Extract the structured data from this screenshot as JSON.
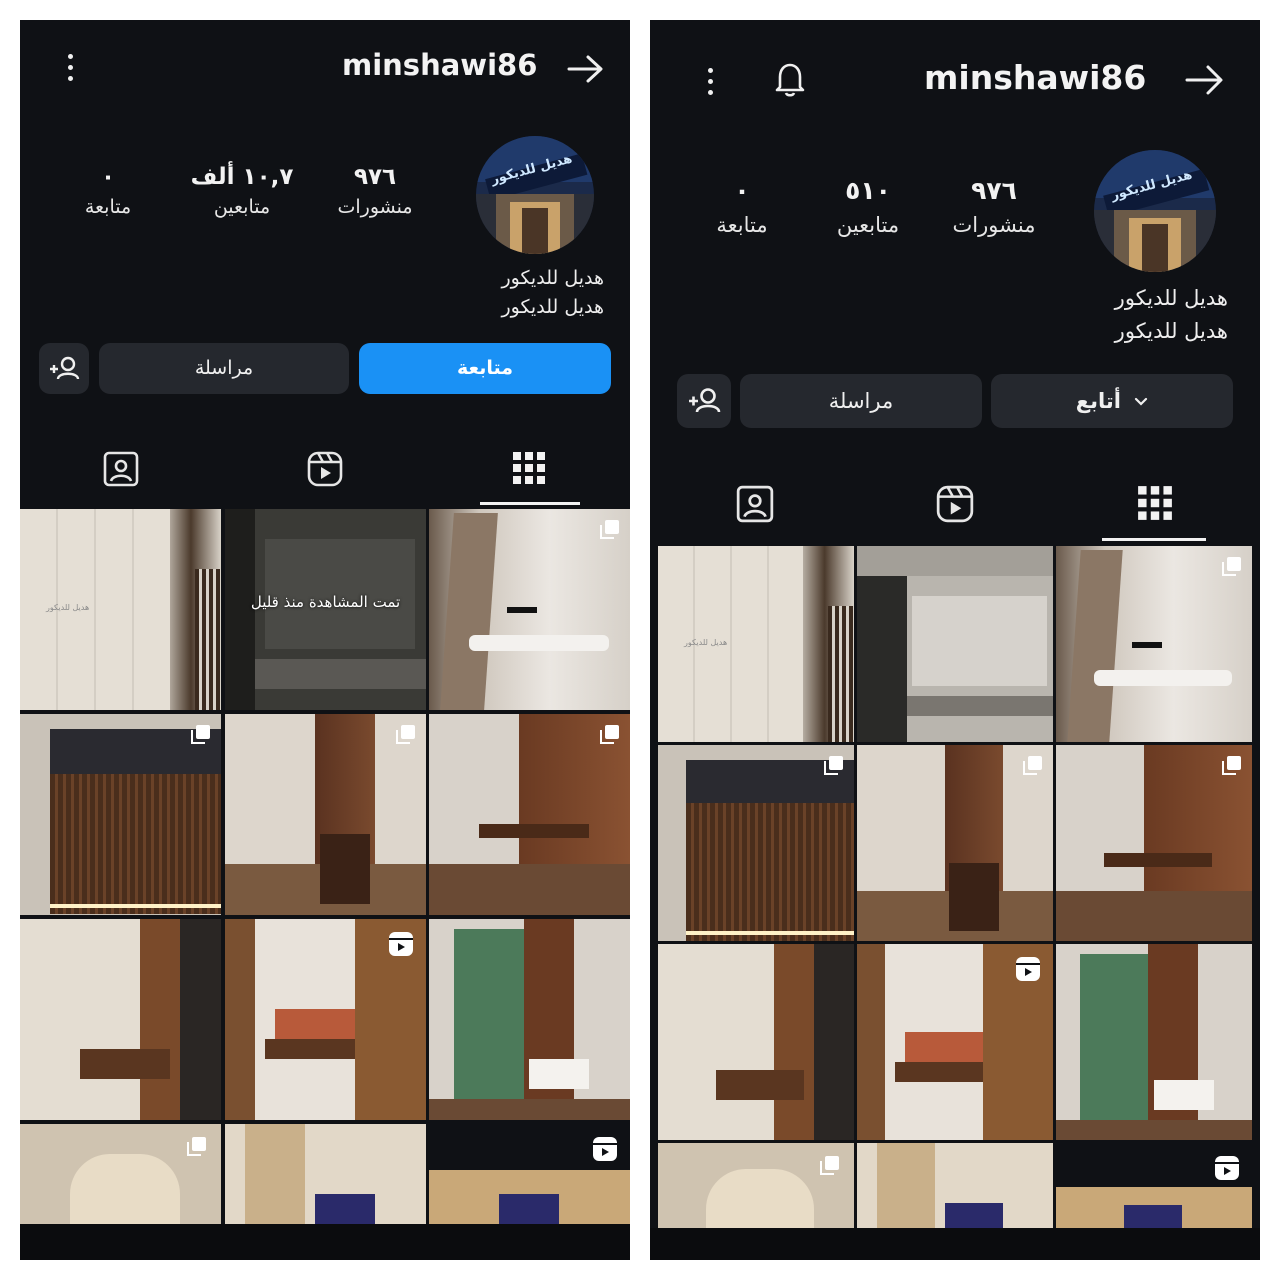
{
  "left": {
    "username": "minshawi86",
    "stats": [
      {
        "value": "٩٧٦",
        "label": "منشورات"
      },
      {
        "value": "١٠,٧ ألف",
        "label": "متابعين"
      },
      {
        "value": "٠",
        "label": "متابعة"
      }
    ],
    "bio_line1": "هديل للديكور",
    "bio_line2": "هديل للديكور",
    "follow_button": "متابعة",
    "message_button": "مراسلة",
    "recently_viewed": "تمت المشاهدة منذ قليل",
    "watermark": "هديل للديكور"
  },
  "right": {
    "username": "minshawi86",
    "stats": [
      {
        "value": "٩٧٦",
        "label": "منشورات"
      },
      {
        "value": "٥١٠",
        "label": "متابعين"
      },
      {
        "value": "٠",
        "label": "متابعة"
      }
    ],
    "bio_line1": "هديل للديكور",
    "bio_line2": "هديل للديكور",
    "following_button": "أتابع",
    "message_button": "مراسلة",
    "watermark": "هديل للديكور"
  },
  "avatar_sign_text": "هديل للديكور",
  "colors": {
    "background": "#0f1115",
    "button_dark": "#25282e",
    "follow_blue": "#1a91f5",
    "text": "#f5f5f5"
  },
  "icons": [
    "more-icon",
    "bell-icon",
    "arrow-right-icon",
    "add-person-icon",
    "tagged-icon",
    "reels-icon",
    "grid-icon",
    "multi-post-icon",
    "reel-badge-icon",
    "chevron-down-icon"
  ]
}
